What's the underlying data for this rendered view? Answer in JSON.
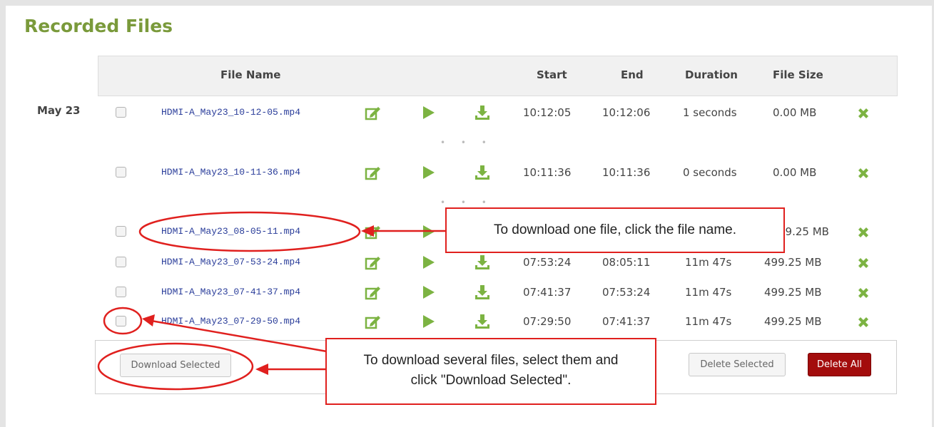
{
  "page": {
    "title": "Recorded Files"
  },
  "table": {
    "headers": {
      "file_name": "File Name",
      "start": "Start",
      "end": "End",
      "duration": "Duration",
      "file_size": "File Size"
    },
    "date_group": "May 23",
    "rows": [
      {
        "name": "HDMI-A_May23_10-12-05.mp4",
        "start": "10:12:05",
        "end": "10:12:06",
        "duration": "1 seconds",
        "size": "0.00 MB"
      },
      {
        "name": "HDMI-A_May23_10-11-36.mp4",
        "start": "10:11:36",
        "end": "10:11:36",
        "duration": "0 seconds",
        "size": "0.00 MB"
      },
      {
        "name": "HDMI-A_May23_08-05-11.mp4",
        "start": "",
        "end": "",
        "duration": "",
        "size": "99.25 MB"
      },
      {
        "name": "HDMI-A_May23_07-53-24.mp4",
        "start": "07:53:24",
        "end": "08:05:11",
        "duration": "11m 47s",
        "size": "499.25 MB"
      },
      {
        "name": "HDMI-A_May23_07-41-37.mp4",
        "start": "07:41:37",
        "end": "07:53:24",
        "duration": "11m 47s",
        "size": "499.25 MB"
      },
      {
        "name": "HDMI-A_May23_07-29-50.mp4",
        "start": "07:29:50",
        "end": "07:41:37",
        "duration": "11m 47s",
        "size": "499.25 MB"
      }
    ],
    "ellipsis": "• • •"
  },
  "buttons": {
    "download_selected": "Download Selected",
    "delete_selected": "Delete Selected",
    "delete_all": "Delete All"
  },
  "callouts": {
    "one_file": "To download one file, click the file name.",
    "several_files_line1": "To download several files, select them and",
    "several_files_line2": "click \"Download Selected\"."
  },
  "colors": {
    "title_green": "#7a9a3b",
    "icon_green": "#7cb342",
    "delete_red": "#a30c0c",
    "annotation_red": "#e0201e",
    "link_blue": "#2a3d9a"
  },
  "icons": [
    "edit-icon",
    "play-icon",
    "download-icon",
    "delete-x-icon"
  ]
}
